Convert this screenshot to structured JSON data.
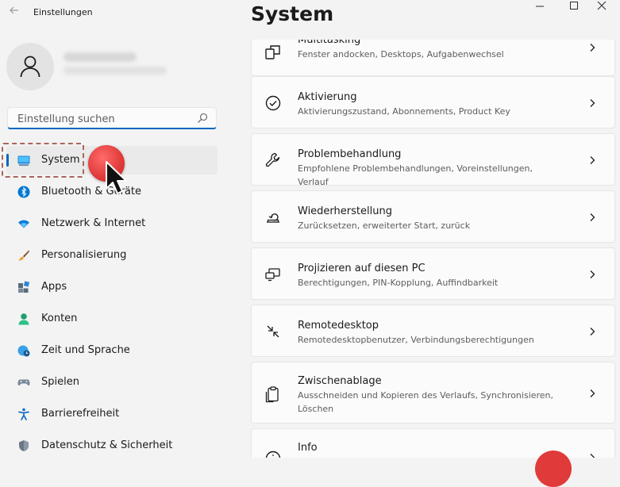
{
  "window": {
    "title": "Einstellungen",
    "back_icon": "back-arrow-icon",
    "controls": [
      "minimize-icon",
      "maximize-icon",
      "close-icon"
    ]
  },
  "sidebar": {
    "search_placeholder": "Einstellung suchen",
    "items": [
      {
        "label": "System",
        "icon": "monitor-icon",
        "selected": true
      },
      {
        "label": "Bluetooth & Geräte",
        "icon": "bluetooth-icon"
      },
      {
        "label": "Netzwerk & Internet",
        "icon": "wifi-icon"
      },
      {
        "label": "Personalisierung",
        "icon": "brush-icon"
      },
      {
        "label": "Apps",
        "icon": "apps-icon"
      },
      {
        "label": "Konten",
        "icon": "user-icon"
      },
      {
        "label": "Zeit und Sprache",
        "icon": "globe-clock-icon"
      },
      {
        "label": "Spielen",
        "icon": "gamepad-icon"
      },
      {
        "label": "Barrierefreiheit",
        "icon": "accessibility-icon"
      },
      {
        "label": "Datenschutz & Sicherheit",
        "icon": "shield-icon"
      }
    ]
  },
  "main": {
    "title": "System",
    "cards": [
      {
        "title": "Multitasking",
        "subtitle": "Fenster andocken, Desktops, Aufgabenwechsel",
        "icon": "multitasking-icon"
      },
      {
        "title": "Aktivierung",
        "subtitle": "Aktivierungszustand, Abonnements, Product Key",
        "icon": "check-circle-icon"
      },
      {
        "title": "Problembehandlung",
        "subtitle": "Empfohlene Problembehandlungen, Voreinstellungen, Verlauf",
        "icon": "wrench-icon"
      },
      {
        "title": "Wiederherstellung",
        "subtitle": "Zurücksetzen, erweiterter Start, zurück",
        "icon": "recovery-icon"
      },
      {
        "title": "Projizieren auf diesen PC",
        "subtitle": "Berechtigungen, PIN-Kopplung, Auffindbarkeit",
        "icon": "project-icon"
      },
      {
        "title": "Remotedesktop",
        "subtitle": "Remotedesktopbenutzer, Verbindungsberechtigungen",
        "icon": "remote-desktop-icon"
      },
      {
        "title": "Zwischenablage",
        "subtitle": "Ausschneiden und Kopieren des Verlaufs, Synchronisieren, Löschen",
        "icon": "clipboard-icon"
      },
      {
        "title": "Info",
        "subtitle": "",
        "icon": "info-icon"
      }
    ]
  },
  "colors": {
    "accent": "#0067c0",
    "background": "#f3f3f3",
    "card": "#fbfbfb",
    "annotation": "#e03a3a"
  }
}
